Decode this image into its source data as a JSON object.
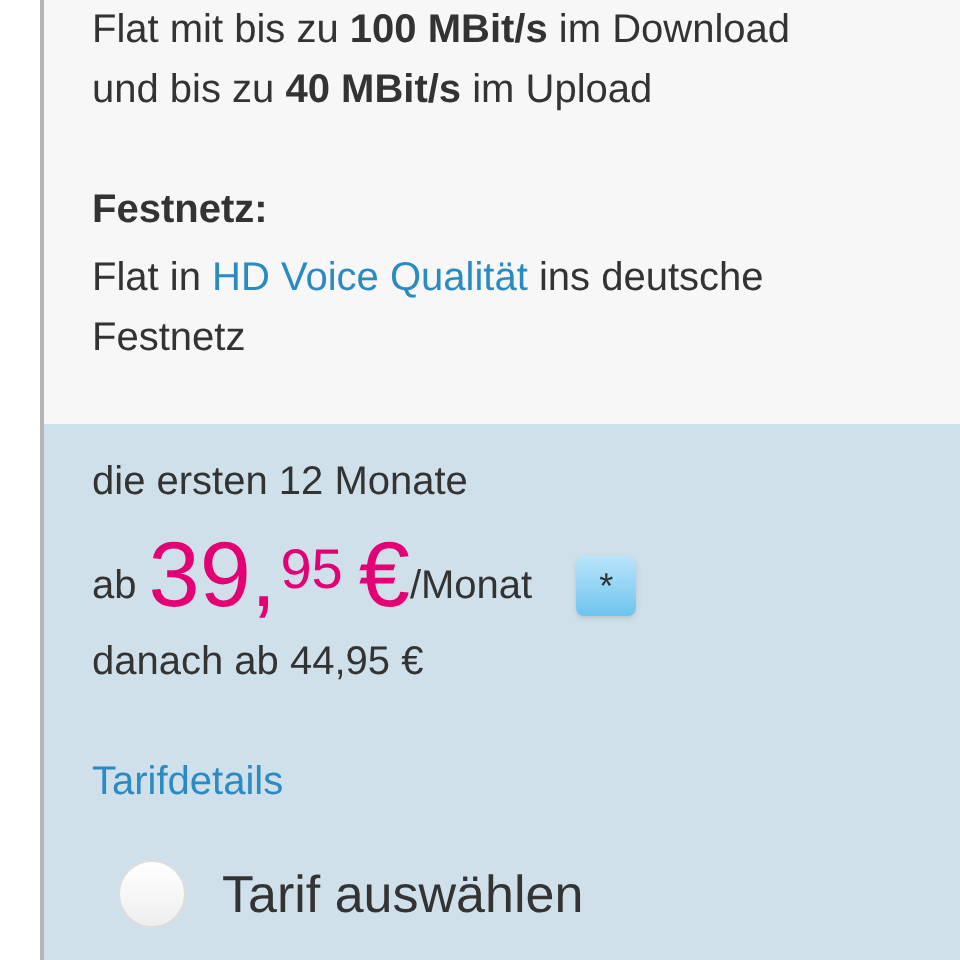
{
  "features": {
    "lines": [
      "Flat mit bis zu **100 MBit/s** im Download",
      "und bis zu **40 MBit/s** im Upload"
    ]
  },
  "festnetz": {
    "heading": "Festnetz:",
    "text_before": "Flat in",
    "link": "HD Voice Qualität",
    "text_after": "ins deutsche Festnetz"
  },
  "price": {
    "period": "die ersten 12 Monate",
    "prefix": "ab",
    "euros": "39,",
    "cents": "95",
    "currency": "€",
    "unit": "/Monat",
    "note_button": "*",
    "after": "danach ab 44,95 €"
  },
  "details_link": "Tarifdetails",
  "select": {
    "label": "Tarif auswählen",
    "selected": false
  }
}
